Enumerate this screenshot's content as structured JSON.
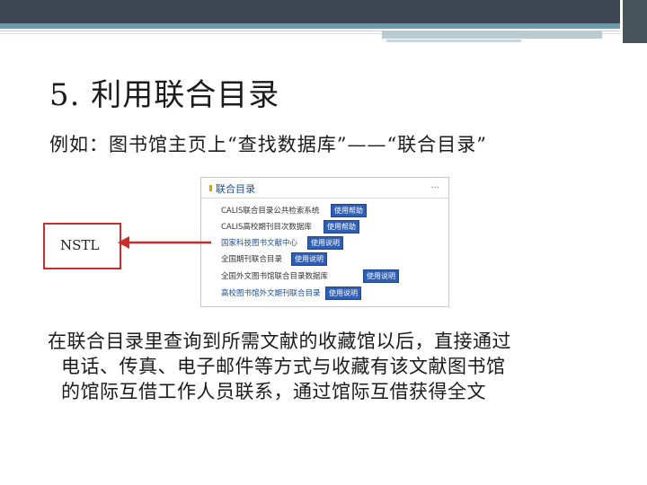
{
  "slide": {
    "title": "5. 利用联合目录",
    "subtitle": "例如：图书馆主页上“查找数据库”——“联合目录”",
    "callout": "NSTL",
    "body": [
      "在联合目录里查询到所需文献的收藏馆以后，直接通过",
      "电话、传真、电子邮件等方式与收藏有该文献图书馆",
      "的馆际互借工作人员联系，通过馆际互借获得全文"
    ]
  },
  "panel": {
    "title": "联合目录",
    "more": "...",
    "items": [
      {
        "label": "CALIS联合目录公共检索系统",
        "button": "使用帮助"
      },
      {
        "label": "CALIS高校期刊目次数据库",
        "button": "使用帮助"
      },
      {
        "label": "国家科技图书文献中心",
        "button": "使用说明"
      },
      {
        "label": "全国期刊联合目录",
        "button": "使用说明"
      },
      {
        "label": "全国外文图书馆联合目录数据库",
        "button": "使用说明"
      },
      {
        "label": "高校图书馆外文期刊联合目录",
        "button": "使用说明"
      }
    ]
  },
  "colors": {
    "header_dark": "#3e4553",
    "header_teal": "#6d9aa6",
    "callout_border": "#cc2b2b",
    "button_blue": "#2f5fb5",
    "link_blue": "#1d4f99"
  }
}
